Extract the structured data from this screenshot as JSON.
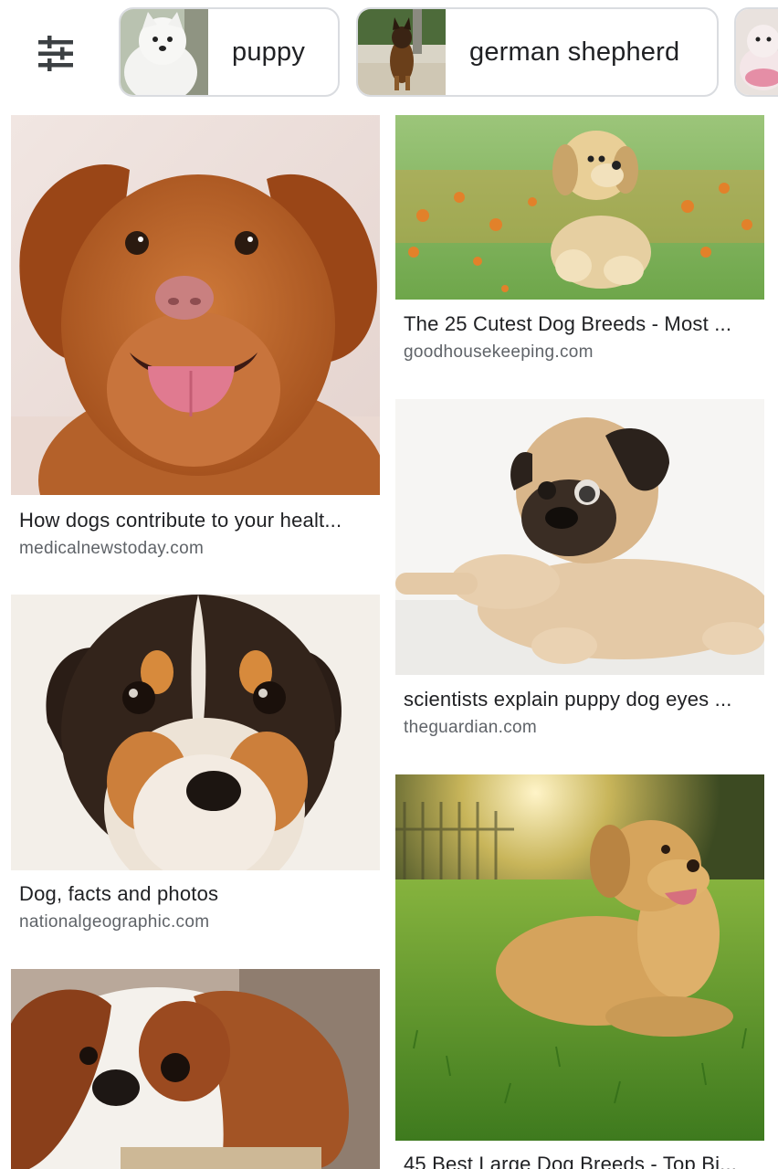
{
  "filters": {
    "icon": "tune-icon",
    "chips": [
      {
        "label": "puppy",
        "thumb": "white-puppy-thumbnail"
      },
      {
        "label": "german shepherd",
        "thumb": "german-shepherd-thumbnail"
      },
      {
        "label": "",
        "thumb": "toy-puppy-thumbnail"
      }
    ]
  },
  "results": [
    {
      "title": "How dogs contribute to your healt...",
      "site": "medicalnewstoday.com",
      "image": "brown retriever puppy smiling"
    },
    {
      "title": "The 25 Cutest Dog Breeds - Most ...",
      "site": "goodhousekeeping.com",
      "image": "golden puppy sitting in a flower field"
    },
    {
      "title": "scientists explain puppy dog eyes ...",
      "site": "theguardian.com",
      "image": "pug puppy lying down"
    },
    {
      "title": "Dog, facts and photos",
      "site": "nationalgeographic.com",
      "image": "tri-color puppy face close-up"
    },
    {
      "title": "45 Best Large Dog Breeds - Top Bi...",
      "site": "",
      "image": "golden retriever lying on grass in sunlight"
    },
    {
      "title": "",
      "site": "",
      "image": "cavalier king charles spaniel resting"
    }
  ],
  "colors": {
    "chip_border": "#dadce0",
    "title_text": "#202124",
    "site_text": "#5f6368"
  }
}
